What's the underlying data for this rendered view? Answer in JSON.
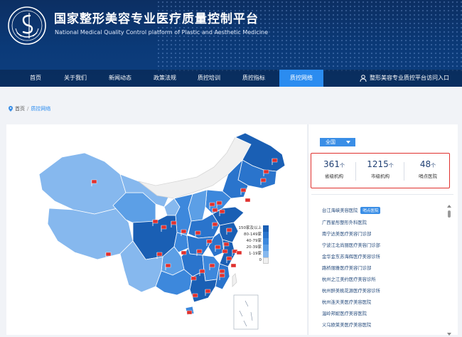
{
  "site": {
    "title": "国家整形美容专业医疗质量控制平台",
    "subtitle": "National Medical Quality Control platform of Plastic and Aesthetic Medicine"
  },
  "nav": {
    "items": [
      "首页",
      "关于我们",
      "新闻动态",
      "政策法规",
      "质控培训",
      "质控指标",
      "质控网络"
    ],
    "active_index": 6,
    "portal_label": "整形美容专业质控平台访问入口"
  },
  "breadcrumb": {
    "home": "首页",
    "separator": "/",
    "current": "质控网络"
  },
  "legend": {
    "entries": [
      "150家及以上",
      "80-149家",
      "40-79家",
      "20-39家",
      "1-19家",
      "0"
    ],
    "colors": [
      "#1a5fb4",
      "#2a74cc",
      "#3d88dc",
      "#5c9fe6",
      "#86b8ee",
      "#f0f0f0"
    ]
  },
  "map": {
    "flag_color": "#e0312e",
    "hospital_flag_count": 38
  },
  "region_select": {
    "value": "全国"
  },
  "stats": [
    {
      "value": "361",
      "unit": "个",
      "label": "省级机构"
    },
    {
      "value": "1215",
      "unit": "个",
      "label": "市级机构"
    },
    {
      "value": "48",
      "unit": "个",
      "label": "哨点医院"
    }
  ],
  "hospital_list": [
    {
      "name": "台江海峡美容医院",
      "badge": "哨点医院"
    },
    {
      "name": "广西星彤整形外科医院"
    },
    {
      "name": "南宁达美医疗美容门诊部"
    },
    {
      "name": "宁波江北尚丽医疗美容门诊部"
    },
    {
      "name": "金华金东苏海辉医疗美容诊所"
    },
    {
      "name": "路桥丽雅医疗美容门诊部"
    },
    {
      "name": "杭州之江美约医疗美容诊所"
    },
    {
      "name": "杭州醉美桃花源医疗美容诊所"
    },
    {
      "name": "杭州连天美医疗美容医院"
    },
    {
      "name": "温岭邦妮医疗美容医院"
    },
    {
      "name": "义乌欧莱美医疗美容医院"
    }
  ]
}
